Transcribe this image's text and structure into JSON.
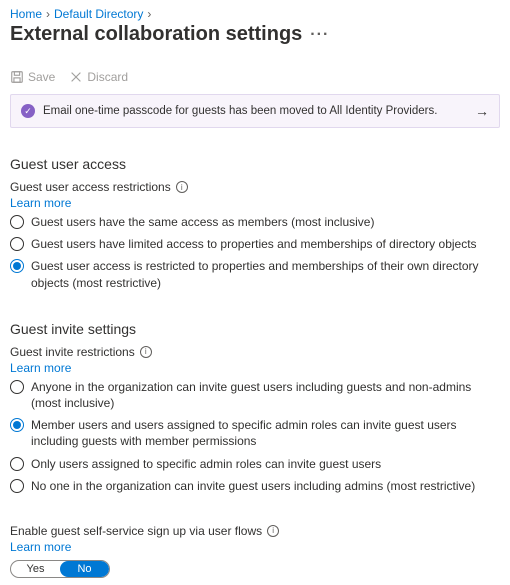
{
  "breadcrumb": {
    "home": "Home",
    "dir": "Default Directory"
  },
  "page_title": "External collaboration settings",
  "toolbar": {
    "save": "Save",
    "discard": "Discard"
  },
  "notice": {
    "text": "Email one-time passcode for guests has been moved to All Identity Providers."
  },
  "sections": {
    "guest_access": {
      "heading": "Guest user access",
      "field_label": "Guest user access restrictions",
      "learn_more": "Learn more",
      "options": [
        "Guest users have the same access as members (most inclusive)",
        "Guest users have limited access to properties and memberships of directory objects",
        "Guest user access is restricted to properties and memberships of their own directory objects (most restrictive)"
      ],
      "selected_index": 2
    },
    "guest_invite": {
      "heading": "Guest invite settings",
      "field_label": "Guest invite restrictions",
      "learn_more": "Learn more",
      "options": [
        "Anyone in the organization can invite guest users including guests and non-admins (most inclusive)",
        "Member users and users assigned to specific admin roles can invite guest users including guests with member permissions",
        "Only users assigned to specific admin roles can invite guest users",
        "No one in the organization can invite guest users including admins (most restrictive)"
      ],
      "selected_index": 1
    },
    "self_service": {
      "field_label": "Enable guest self-service sign up via user flows",
      "learn_more": "Learn more",
      "yes": "Yes",
      "no": "No",
      "value": "No"
    }
  }
}
